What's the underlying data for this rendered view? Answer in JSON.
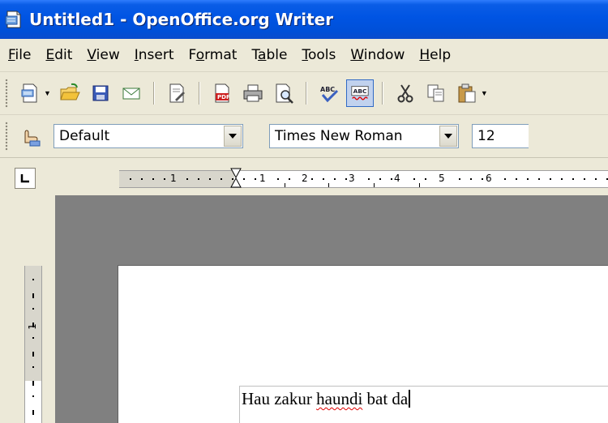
{
  "window": {
    "title": "Untitled1 - OpenOffice.org Writer"
  },
  "menubar": {
    "items": [
      "File",
      "Edit",
      "View",
      "Insert",
      "Format",
      "Table",
      "Tools",
      "Window",
      "Help"
    ]
  },
  "toolbar_standard": {
    "buttons": [
      "new-document",
      "open",
      "save",
      "email",
      "edit-file",
      "export-pdf",
      "print",
      "page-preview",
      "spellcheck",
      "autospellcheck",
      "cut",
      "copy",
      "paste"
    ]
  },
  "toolbar_formatting": {
    "paragraph_style": "Default",
    "font_name": "Times New Roman",
    "font_size": "12"
  },
  "ruler": {
    "horizontal_labels": [
      "1",
      "1",
      "2",
      "3",
      "4",
      "5",
      "6"
    ],
    "vertical_labels": [
      "1"
    ]
  },
  "document": {
    "words": [
      {
        "text": "Hau zakur ",
        "misspelled": false
      },
      {
        "text": "haundi",
        "misspelled": true
      },
      {
        "text": " bat da",
        "misspelled": false
      }
    ]
  },
  "colors": {
    "titlebar": "#0054e3",
    "chrome": "#ece9d8",
    "workspace": "#808080",
    "spell_underline": "#e00000"
  }
}
